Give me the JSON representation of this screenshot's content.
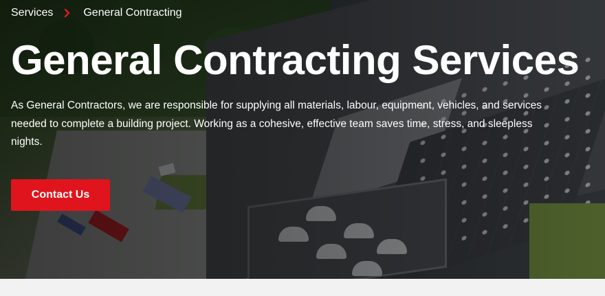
{
  "breadcrumb": {
    "items": [
      {
        "label": "Services"
      },
      {
        "label": "General Contracting"
      }
    ],
    "separator_icon": "chevron-right-icon"
  },
  "hero": {
    "title": "General Contracting Services",
    "intro": "As General Contractors, we are responsible for supplying all materials, labour, equipment, vehicles, and services needed to complete a building project.  Working as a cohesive, effective team saves time, stress, and sleepless nights.",
    "cta_label": "Contact Us",
    "background_image": "aerial-industrial-warehouse-photo"
  },
  "colors": {
    "accent": "#e0141c",
    "text": "#ffffff",
    "page_background": "#f2f2f2"
  }
}
